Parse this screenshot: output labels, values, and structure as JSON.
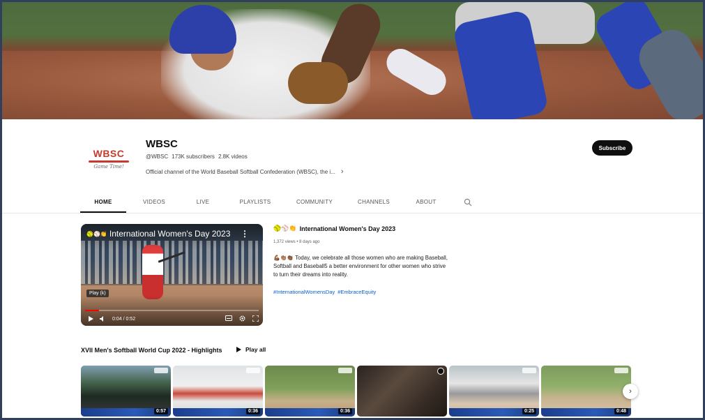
{
  "channel": {
    "logo_text": "WBSC",
    "logo_script": "Game Time!",
    "name": "WBSC",
    "handle": "@WBSC",
    "subscribers": "173K subscribers",
    "videos_count": "2.8K videos",
    "description": "Official channel of the World Baseball Softball Confederation (WBSC), the i...",
    "subscribe_label": "Subscribe"
  },
  "tabs": [
    {
      "label": "HOME",
      "active": true
    },
    {
      "label": "VIDEOS"
    },
    {
      "label": "LIVE"
    },
    {
      "label": "PLAYLISTS"
    },
    {
      "label": "COMMUNITY"
    },
    {
      "label": "CHANNELS"
    },
    {
      "label": "ABOUT"
    }
  ],
  "featured": {
    "player_title": "International Women's Day 2023",
    "player_emojis": "🥎⚾👏",
    "tooltip": "Play (k)",
    "time": "0:04 / 0:52",
    "progress": 0.08,
    "title": "International Women's Day 2023",
    "title_emojis": "🥎⚾👏",
    "meta": "1,372 views • 8 days ago",
    "description_emojis": "💪🏾👏🏽👏🏾",
    "description": "Today, we celebrate all those women who are making Baseball, Softball and Baseball5 a better environment for other women who strive to turn their dreams into reality.",
    "hashtags": [
      "#InternationalWomensDay",
      "#EmbraceEquity"
    ]
  },
  "section": {
    "title": "XVII Men's Softball World Cup 2022 - Highlights",
    "play_all": "Play all",
    "videos": [
      {
        "duration": "0:57"
      },
      {
        "duration": "0:36"
      },
      {
        "duration": "0:36"
      },
      {
        "duration": ""
      },
      {
        "duration": "0:25"
      },
      {
        "duration": "0:48"
      }
    ]
  },
  "colors": {
    "accent_red": "#ff0000",
    "link_blue": "#065fd4",
    "subscribe_bg": "#0f0f0f"
  }
}
